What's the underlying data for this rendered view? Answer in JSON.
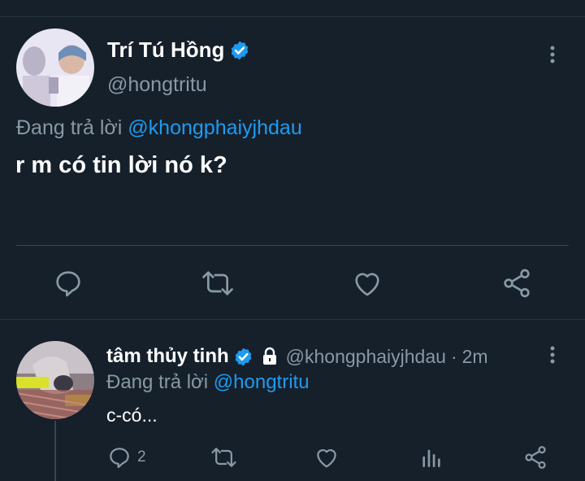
{
  "main_tweet": {
    "display_name": "Trí Tú Hồng",
    "handle": "@hongtritu",
    "reply_prefix": "Đang trả lời",
    "reply_to": "@khongphaiyjhdau",
    "text": "r m có tin lời nó k?",
    "verified": true,
    "icons": [
      "more-vertical-icon",
      "reply-icon",
      "retweet-icon",
      "like-icon",
      "share-icon"
    ]
  },
  "reply_tweet": {
    "display_name": "tâm thủy tinh",
    "handle": "@khongphaiyjhdau",
    "separator": "·",
    "time": "2m",
    "reply_prefix": "Đang trả lời",
    "reply_to": "@hongtritu",
    "text": "c-có...",
    "verified": true,
    "protected": true,
    "reply_count": "2",
    "icons": [
      "more-vertical-icon",
      "reply-icon",
      "retweet-icon",
      "like-icon",
      "analytics-icon",
      "share-icon"
    ]
  },
  "colors": {
    "background": "#15202b",
    "accent": "#1d9bf0",
    "secondary_text": "#8899a6",
    "divider": "#38444d"
  }
}
